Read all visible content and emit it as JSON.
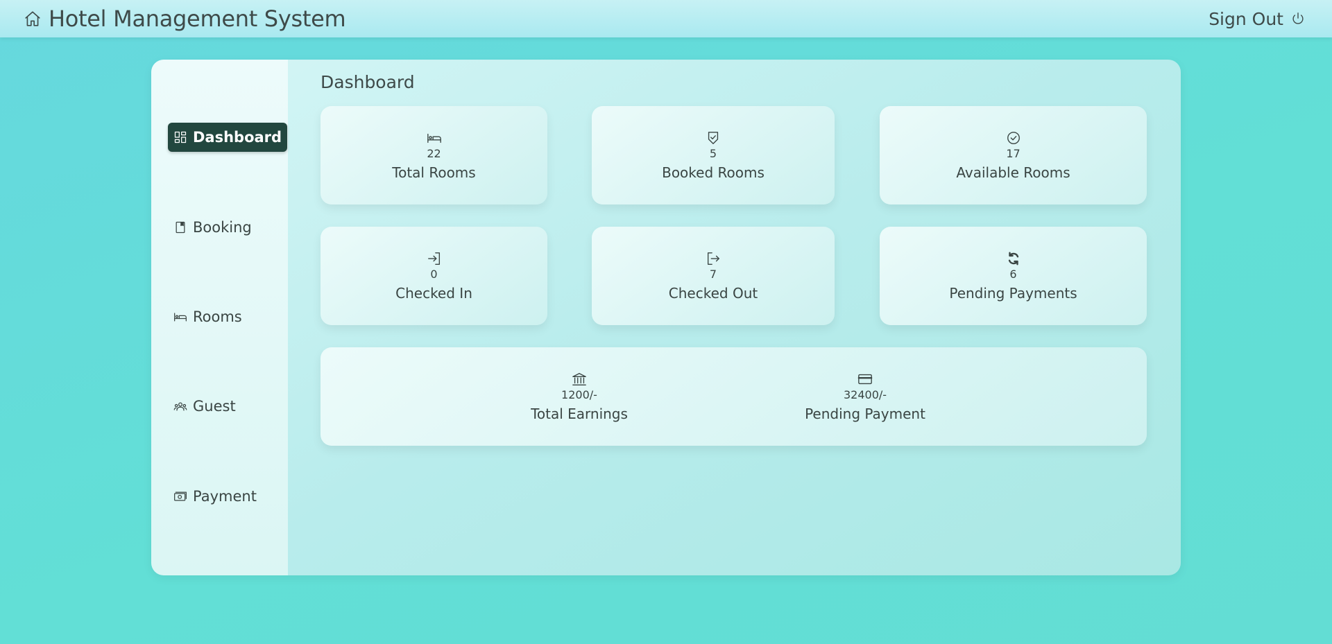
{
  "header": {
    "title": "Hotel Management System",
    "signout_label": "Sign Out",
    "home_icon": "home-icon",
    "power_icon": "power-icon"
  },
  "sidebar": {
    "items": [
      {
        "label": "Dashboard",
        "icon": "dashboard-grid-icon",
        "active": true
      },
      {
        "label": "Booking",
        "icon": "booking-book-icon",
        "active": false
      },
      {
        "label": "Rooms",
        "icon": "bed-icon",
        "active": false
      },
      {
        "label": "Guest",
        "icon": "people-icon",
        "active": false
      },
      {
        "label": "Payment",
        "icon": "cash-icon",
        "active": false
      }
    ]
  },
  "main": {
    "title": "Dashboard",
    "cards": [
      {
        "value": "22",
        "label": "Total Rooms",
        "icon": "bed-icon"
      },
      {
        "value": "5",
        "label": "Booked Rooms",
        "icon": "shield-check-icon"
      },
      {
        "value": "17",
        "label": "Available Rooms",
        "icon": "check-circle-icon"
      },
      {
        "value": "0",
        "label": "Checked In",
        "icon": "sign-in-icon"
      },
      {
        "value": "7",
        "label": "Checked Out",
        "icon": "sign-out-icon"
      },
      {
        "value": "6",
        "label": "Pending Payments",
        "icon": "refresh-icon"
      }
    ],
    "summary": [
      {
        "value": "1200/-",
        "label": "Total Earnings",
        "icon": "bank-icon"
      },
      {
        "value": "32400/-",
        "label": "Pending Payment",
        "icon": "credit-card-icon"
      }
    ]
  },
  "colors": {
    "active_nav": "#22473f",
    "background": "#63ddd4",
    "text": "#3a4543"
  }
}
